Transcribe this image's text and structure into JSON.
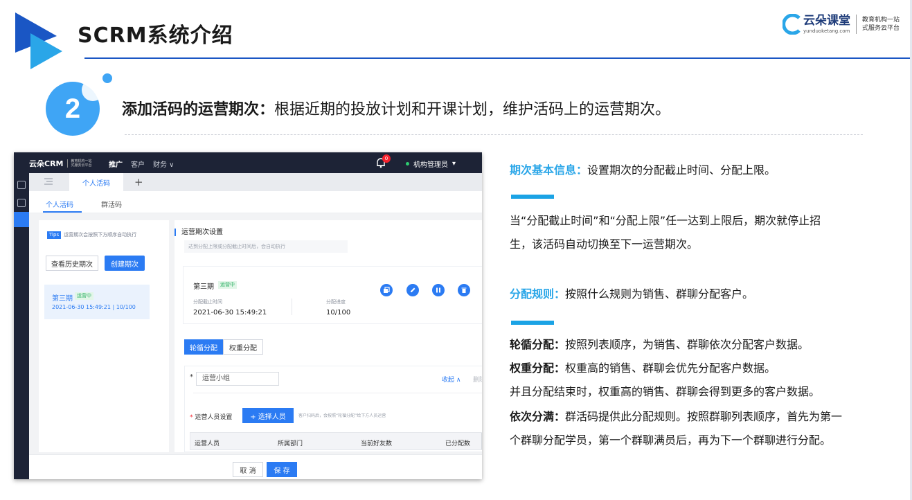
{
  "slide": {
    "title": "SCRM系统介绍",
    "brand": {
      "name": "云朵课堂",
      "domain": "yunduoketang.com",
      "slogan_line1": "教育机构一站",
      "slogan_line2": "式服务云平台"
    },
    "colors": {
      "accent": "#3fa5f5",
      "highlight": "#2aa6e8",
      "header_line": "#1a56c4"
    }
  },
  "step": {
    "number": "2",
    "heading": "添加活码的运营期次",
    "colon": "：",
    "text": "根据近期的投放计划和开课计划，维护活码上的运营期次。"
  },
  "app": {
    "logo": "云朵CRM",
    "logo_slogan_1": "教育机构一站",
    "logo_slogan_2": "式服务云平台",
    "nav": [
      "推广",
      "客户",
      "财务 ∨"
    ],
    "bell_count": "0",
    "user": "机构管理员",
    "user_caret": "▾",
    "tab_personal": "个人活码",
    "tab_plus": "+",
    "subtabs": [
      "个人活码",
      "群活码"
    ],
    "tips_tag": "Tips",
    "tips_text": "运营期次会按照下方顺序自动执行",
    "btn_history": "查看历史期次",
    "btn_create": "创建期次",
    "period": {
      "name": "第三期",
      "status": "运营中",
      "datetime": "2021-06-30 15:49:21 | 10/100"
    },
    "settings_title": "运营期次设置",
    "settings_hint": "达到分配上限或分配截止时间后，会自动执行",
    "card": {
      "name": "第三期",
      "status": "运营中",
      "deadline_label": "分配截止时间",
      "deadline_value": "2021-06-30 15:49:21",
      "progress_label": "分配进度",
      "progress_value": "10/100",
      "icons": [
        "copy-icon",
        "edit-icon",
        "pause-icon",
        "delete-icon"
      ]
    },
    "rule_tabs": [
      "轮循分配",
      "权重分配"
    ],
    "group_req": "*",
    "group_placeholder": "运营小组",
    "fold": "收起 ∧",
    "delete": "删除",
    "staff_label": "运营人员设置",
    "btn_select": "+ 选择人员",
    "staff_hint": "客户扫码后，会按照“轮循分配”给下方人员运营",
    "table_headers": [
      "运营人员",
      "所属部门",
      "当前好友数",
      "已分配数"
    ],
    "btn_cancel": "取 消",
    "btn_save": "保 存"
  },
  "desc": {
    "p1_label": "期次基本信息：",
    "p1_text": "设置期次的分配截止时间、分配上限。",
    "p2_line1": "当“分配截止时间”和“分配上限”任一达到上限后，期次就停止招",
    "p2_line2": "生，该活码自动切换至下一运营期次。",
    "p3_label": "分配规则：",
    "p3_text": "按照什么规则为销售、群聊分配客户。",
    "l1_label": "轮循分配：",
    "l1_text": "按照列表顺序，为销售、群聊依次分配客户数据。",
    "l2_label": "权重分配：",
    "l2_text": "权重高的销售、群聊会优先分配客户数据。",
    "l3_text": "并且分配结束时，权重高的销售、群聊会得到更多的客户数据。",
    "l4_label": "依次分满：",
    "l4_text": "群活码提供此分配规则。按照群聊列表顺序，首先为第一",
    "l5_text": "个群聊分配学员，第一个群聊满员后，再为下一个群聊进行分配。"
  }
}
